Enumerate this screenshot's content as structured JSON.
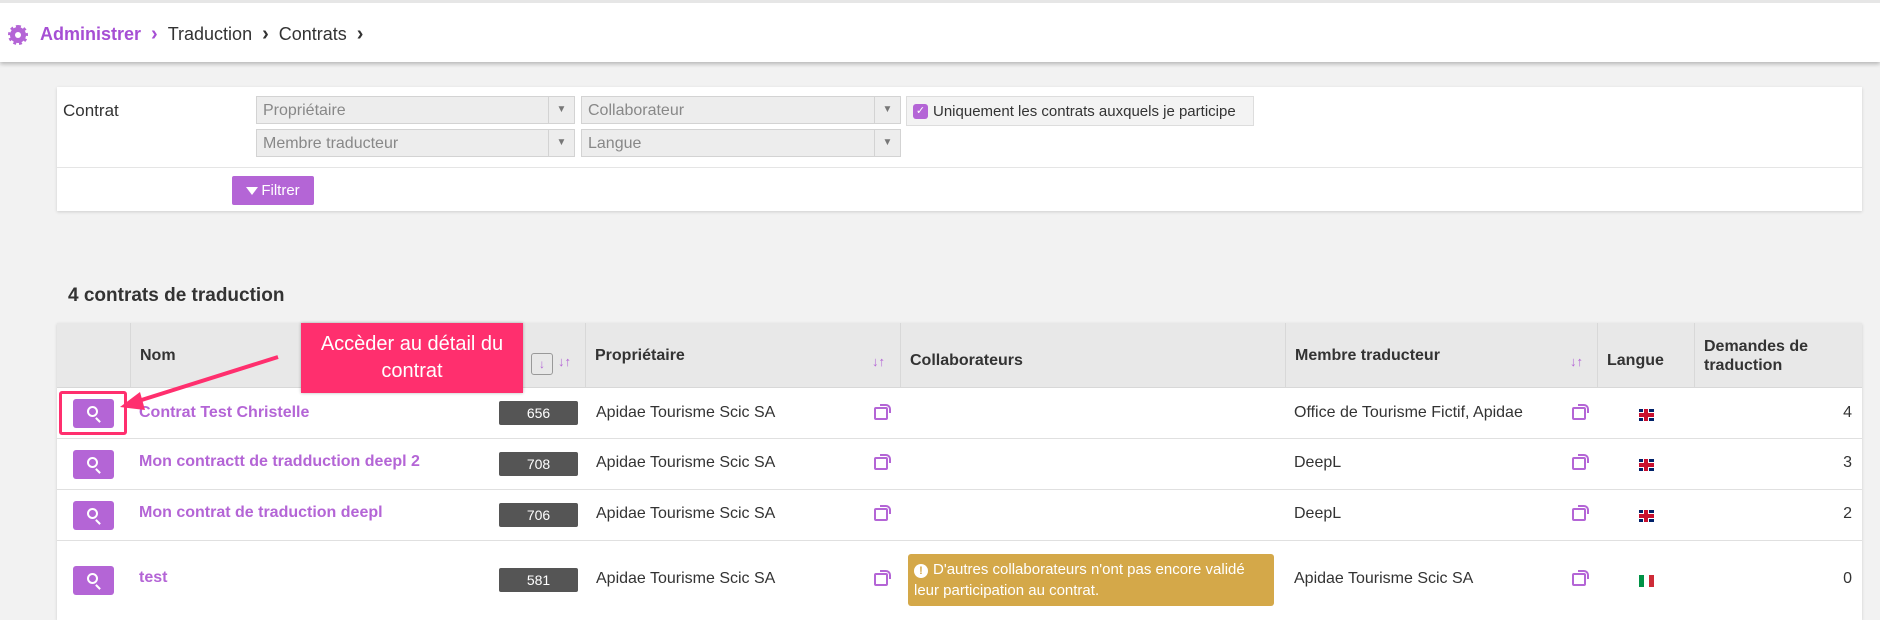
{
  "breadcrumb": {
    "icon": "gear-icon",
    "items": [
      "Administrer",
      "Traduction",
      "Contrats"
    ]
  },
  "filter": {
    "label": "Contrat",
    "owner_placeholder": "Propriétaire",
    "collaborator_placeholder": "Collaborateur",
    "translator_placeholder": "Membre traducteur",
    "language_placeholder": "Langue",
    "only_mine_label": "Uniquement les contrats auxquels je participe",
    "only_mine_checked": true,
    "filter_button": "Filtrer"
  },
  "list": {
    "count_text": "4 contrats de traduction",
    "headers": {
      "name": "Nom",
      "owner": "Propriétaire",
      "collaborators": "Collaborateurs",
      "translator": "Membre traducteur",
      "language": "Langue",
      "requests": "Demandes de traduction"
    },
    "rows": [
      {
        "name": "Contrat Test Christelle",
        "id": "656",
        "owner": "Apidae Tourisme Scic SA",
        "collaborators": "",
        "translator": "Office de Tourisme Fictif, Apidae",
        "language": "flag-uk-icon",
        "requests": "4"
      },
      {
        "name": "Mon contractt de tradduction deepl 2",
        "id": "708",
        "owner": "Apidae Tourisme Scic SA",
        "collaborators": "",
        "translator": "DeepL",
        "language": "flag-uk-icon",
        "requests": "3"
      },
      {
        "name": "Mon contrat de traduction deepl",
        "id": "706",
        "owner": "Apidae Tourisme Scic SA",
        "collaborators": "",
        "translator": "DeepL",
        "language": "flag-uk-icon",
        "requests": "2"
      },
      {
        "name": "test",
        "id": "581",
        "owner": "Apidae Tourisme Scic SA",
        "collaborators": "D'autres collaborateurs n'ont pas encore validé leur participation au contrat.",
        "translator": "Apidae Tourisme Scic SA",
        "language": "flag-it-icon",
        "requests": "0"
      }
    ]
  },
  "annotation": {
    "callout_text": "Accèder au détail du contrat"
  },
  "colors": {
    "accent": "#b465d6",
    "callout": "#ff2f6e",
    "warning": "#d4a849"
  }
}
